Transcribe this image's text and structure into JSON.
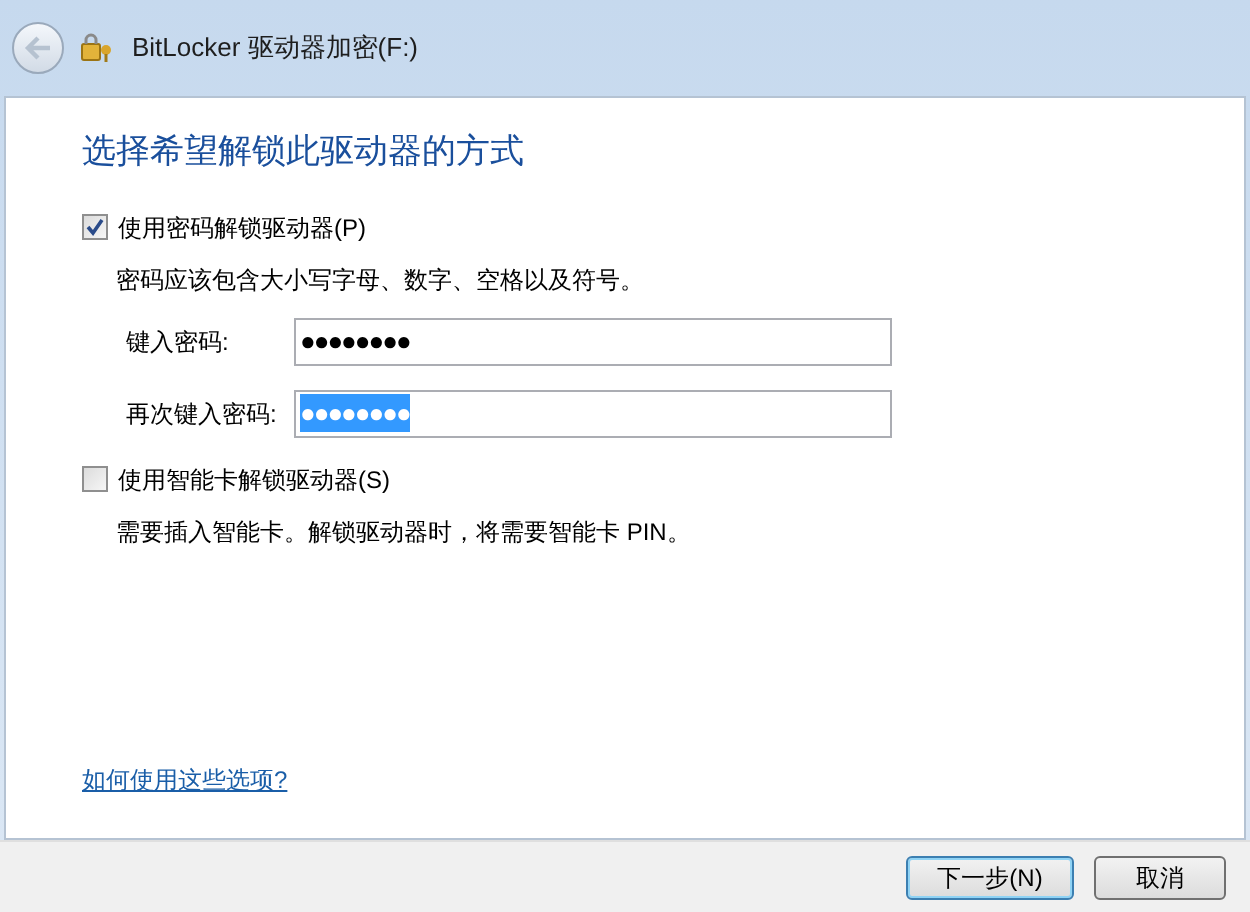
{
  "window": {
    "title": "BitLocker 驱动器加密(F:)"
  },
  "heading": "选择希望解锁此驱动器的方式",
  "options": [
    {
      "label": "使用密码解锁驱动器(P)",
      "checked": true,
      "description": "密码应该包含大小写字母、数字、空格以及符号。",
      "fields": [
        {
          "label": "键入密码:",
          "value": "●●●●●●●●",
          "text_selected": false
        },
        {
          "label": "再次键入密码:",
          "value": "●●●●●●●●",
          "text_selected": true
        }
      ]
    },
    {
      "label": "使用智能卡解锁驱动器(S)",
      "checked": false,
      "description": "需要插入智能卡。解锁驱动器时，将需要智能卡 PIN。"
    }
  ],
  "help_link": "如何使用这些选项?",
  "buttons": [
    {
      "label": "下一步(N)",
      "kind": "default"
    },
    {
      "label": "取消",
      "kind": "normal"
    }
  ]
}
